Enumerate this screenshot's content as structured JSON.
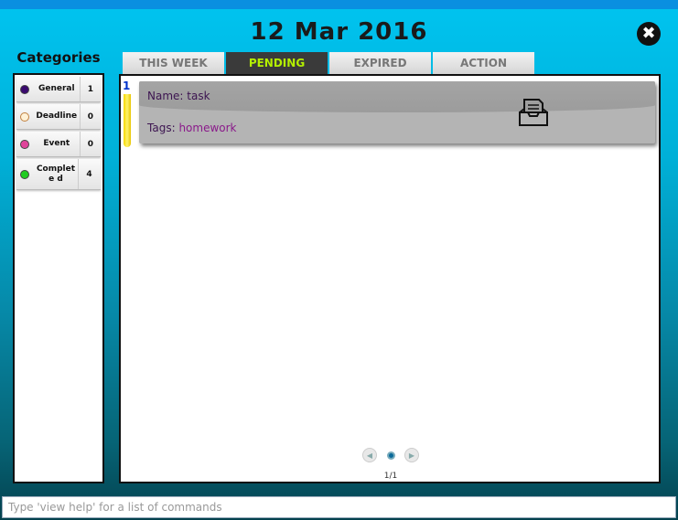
{
  "header": {
    "date": "12 Mar 2016",
    "close_label": "✖"
  },
  "categories": {
    "title": "Categories",
    "items": [
      {
        "name": "General",
        "count": "1",
        "color": "#3a0a6e"
      },
      {
        "name": "Deadline",
        "count": "0",
        "color": "#fff1d6"
      },
      {
        "name": "Event",
        "count": "0",
        "color": "#e0449a"
      },
      {
        "name": "Complete d",
        "count": "4",
        "color": "#22cc22"
      }
    ]
  },
  "tabs": [
    {
      "label": "THIS WEEK",
      "active": false
    },
    {
      "label": "PENDING",
      "active": true
    },
    {
      "label": "EXPIRED",
      "active": false
    },
    {
      "label": "ACTION",
      "active": false
    }
  ],
  "tasks": [
    {
      "index": "1",
      "name_label": "Name:",
      "name": "task",
      "tags_label": "Tags:",
      "tags": "homework",
      "icon": "inbox-icon"
    }
  ],
  "pager": {
    "prev": "◀",
    "next": "▶",
    "label": "1/1"
  },
  "command": {
    "placeholder": "Type 'view help' for a list of commands",
    "value": ""
  },
  "colors": {
    "accent_tab_text": "#b4f000",
    "active_tab_bg": "#3a3a3a",
    "background_top": "#00c4f0",
    "background_bottom": "#04414e"
  }
}
